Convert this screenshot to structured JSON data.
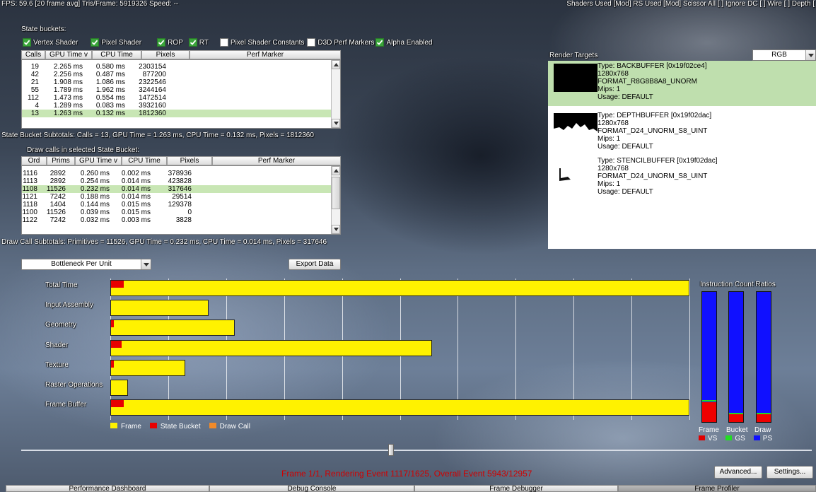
{
  "topbar": {
    "left_text": "FPS: 59.6 [20 frame avg]   Tris/Frame: 5919326   Speed: --",
    "right_text": "Shaders Used [Mod]   RS Used [Mod]   Scissor All [ ]   Ignore DC [ ]   Wire [ ]   Depth ["
  },
  "state_buckets": {
    "title": "State buckets:",
    "checkboxes": [
      {
        "label": "Vertex Shader",
        "checked": true
      },
      {
        "label": "Pixel Shader",
        "checked": true
      },
      {
        "label": "ROP",
        "checked": true
      },
      {
        "label": "RT",
        "checked": true
      },
      {
        "label": "Pixel Shader Constants",
        "checked": false
      },
      {
        "label": "D3D Perf Markers",
        "checked": false
      },
      {
        "label": "Alpha Enabled",
        "checked": true
      }
    ],
    "columns": [
      "Calls",
      "GPU Time  v",
      "CPU Time",
      "Pixels",
      "Perf Marker"
    ],
    "rows": [
      [
        "19",
        "2.265 ms",
        "0.580 ms",
        "2303154",
        ""
      ],
      [
        "42",
        "2.256 ms",
        "0.487 ms",
        "877200",
        ""
      ],
      [
        "21",
        "1.908 ms",
        "1.086 ms",
        "2322546",
        ""
      ],
      [
        "55",
        "1.789 ms",
        "1.962 ms",
        "3244164",
        ""
      ],
      [
        "112",
        "1.473 ms",
        "0.554 ms",
        "1472514",
        ""
      ],
      [
        "4",
        "1.289 ms",
        "0.083 ms",
        "3932160",
        ""
      ],
      [
        "13",
        "1.263 ms",
        "0.132 ms",
        "1812360",
        ""
      ]
    ],
    "selected_row": 6,
    "subtotals": "State Bucket Subtotals: Calls = 13, GPU Time = 1.263 ms, CPU Time = 0.132 ms, Pixels = 1812360"
  },
  "draw_calls": {
    "title": "Draw calls in selected State Bucket:",
    "columns": [
      "Ord",
      "Prims",
      "GPU Time  v",
      "CPU Time",
      "Pixels",
      "Perf Marker"
    ],
    "rows": [
      [
        "1116",
        "2892",
        "0.260 ms",
        "0.002 ms",
        "378936",
        ""
      ],
      [
        "1113",
        "2892",
        "0.254 ms",
        "0.014 ms",
        "423828",
        ""
      ],
      [
        "1108",
        "11526",
        "0.232 ms",
        "0.014 ms",
        "317646",
        ""
      ],
      [
        "1121",
        "7242",
        "0.188 ms",
        "0.014 ms",
        "29514",
        ""
      ],
      [
        "1118",
        "1404",
        "0.144 ms",
        "0.015 ms",
        "129378",
        ""
      ],
      [
        "1100",
        "11526",
        "0.039 ms",
        "0.015 ms",
        "0",
        ""
      ],
      [
        "1122",
        "7242",
        "0.032 ms",
        "0.003 ms",
        "3828",
        ""
      ]
    ],
    "selected_row": 2,
    "subtotals": "Draw Call Subtotals: Primitives = 11526, GPU Time = 0.232 ms, CPU Time = 0.014 ms, Pixels = 317646"
  },
  "controls": {
    "bottleneck_select": "Bottleneck Per Unit",
    "export_button": "Export Data"
  },
  "render_targets": {
    "title": "Render Targets",
    "format_select": "RGB",
    "items": [
      {
        "type": "Type: BACKBUFFER [0x19f02ce4]",
        "size": "1280x768",
        "format": "FORMAT_R8G8B8A8_UNORM",
        "mips": "Mips: 1",
        "usage": "Usage: DEFAULT"
      },
      {
        "type": "Type: DEPTHBUFFER [0x19f02dac]",
        "size": "1280x768",
        "format": "FORMAT_D24_UNORM_S8_UINT",
        "mips": "Mips: 1",
        "usage": "Usage: DEFAULT"
      },
      {
        "type": "Type: STENCILBUFFER [0x19f02dac]",
        "size": "1280x768",
        "format": "FORMAT_D24_UNORM_S8_UINT",
        "mips": "Mips: 1",
        "usage": "Usage: DEFAULT"
      }
    ]
  },
  "chart_data": {
    "type": "bar",
    "categories": [
      "Total Time",
      "Input Assembly",
      "Geometry",
      "Shader",
      "Texture",
      "Raster Operations",
      "Frame Buffer"
    ],
    "series": [
      {
        "name": "Frame",
        "values": [
          100,
          17,
          21.5,
          55.5,
          13,
          3,
          100
        ]
      },
      {
        "name": "State Bucket",
        "values": [
          2.5,
          0,
          0.5,
          2,
          0.5,
          0,
          2.5
        ]
      },
      {
        "name": "Draw Call",
        "values": [
          0,
          0,
          0,
          0,
          0,
          0,
          0
        ]
      }
    ],
    "colors": {
      "Frame": "#fff200",
      "State Bucket": "#e80000",
      "Draw Call": "#f08a2a"
    },
    "xlim": [
      0,
      100
    ],
    "grid": true,
    "legend": "bottom-left"
  },
  "instruction_ratios": {
    "title": "Instruction Count Ratios",
    "bars": [
      {
        "label": "Frame",
        "vs": 0.15,
        "gs": 0.16
      },
      {
        "label": "Bucket",
        "vs": 0.06,
        "gs": 0.06
      },
      {
        "label": "Draw",
        "vs": 0.06,
        "gs": 0.06
      }
    ],
    "legend": [
      "VS",
      "GS",
      "PS"
    ],
    "colors": {
      "VS": "#e00000",
      "GS": "#22dd22",
      "PS": "#1010ff"
    }
  },
  "timeline": {
    "status": "Frame 1/1, Rendering Event 1117/1625, Overall Event 5943/12957",
    "position": 0.464
  },
  "buttons": {
    "advanced": "Advanced...",
    "settings": "Settings..."
  },
  "tabs": [
    "Performance Dashboard",
    "Debug Console",
    "Frame Debugger",
    "Frame Profiler"
  ],
  "active_tab": 3
}
